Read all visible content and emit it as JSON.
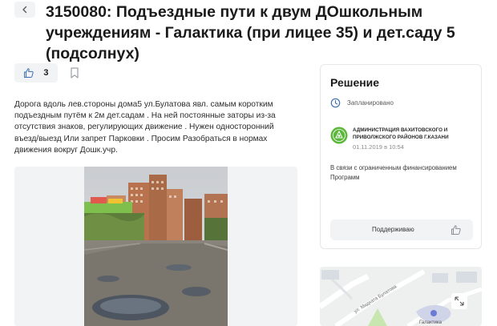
{
  "header": {
    "title": "3150080: Подъездные пути к двум ДОшкольным учреждениям - Галактика (при лицее 35) и дет.саду 5 (подсолнух)"
  },
  "votes": {
    "count": "3"
  },
  "description": "Дорога вдоль лев.стороны дома5 ул.Булатова явл. самым коротким подъездным путём к 2м дет.садам . На ней постоянные заторы из-за отсутствия знаков, регулирующих движение . Нужен односторонний въезд/выезд Или запрет Парковки . Просим Разобраться в нормах движения вокруг Дошк.учр.",
  "decision": {
    "title": "Решение",
    "status": "Запланировано",
    "org_name": "Администрация Вахитовского и Приволжского районов г.Казани",
    "date": "01.11.2019 в 10:54",
    "text": "В связи с ограниченным финансированием Программ",
    "support_label": "Поддерживаю"
  },
  "map": {
    "street_label": "ул. Мидхата Булатова",
    "place_label": "Галактика"
  },
  "colors": {
    "accent": "#3b6fb6",
    "org_logo": "#5cb83c",
    "button_bg": "#f2f3f5"
  }
}
